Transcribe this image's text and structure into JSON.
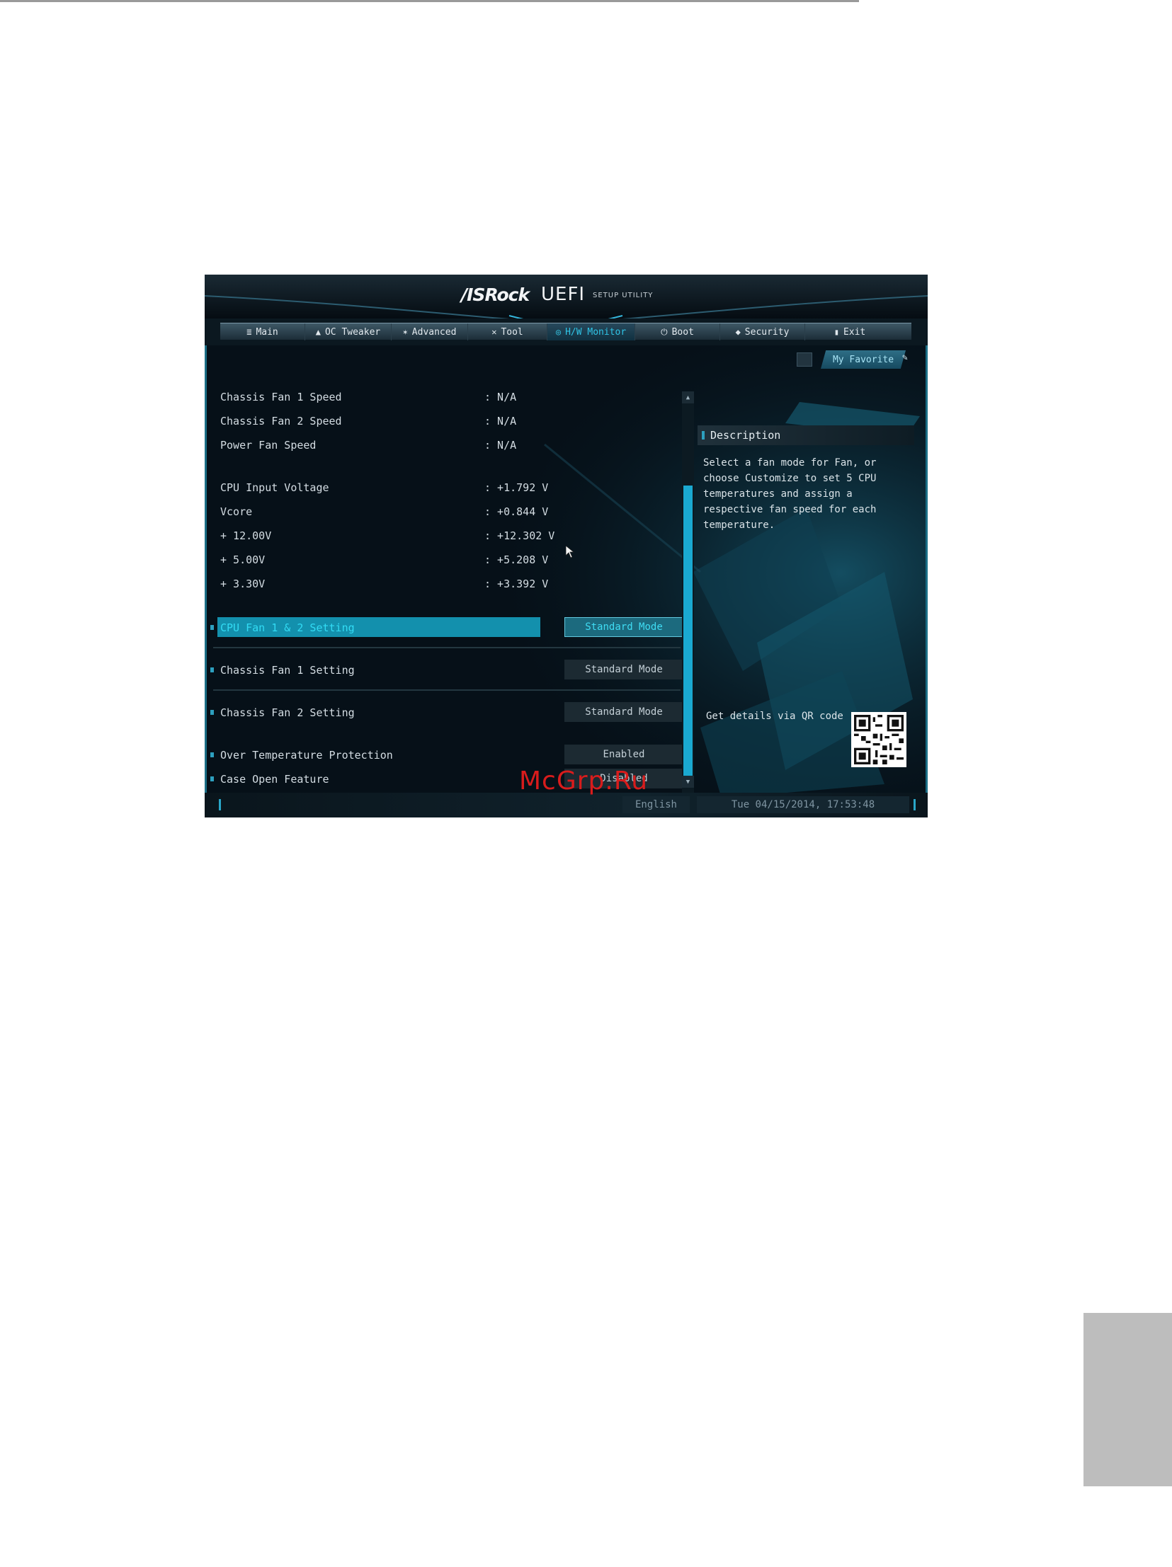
{
  "bios": {
    "brand": "/ISRock",
    "uefi": "UEFI",
    "setup": "SETUP UTILITY",
    "tabs": [
      {
        "label": "Main",
        "icon": "≣"
      },
      {
        "label": "OC Tweaker",
        "icon": "▲"
      },
      {
        "label": "Advanced",
        "icon": "✶"
      },
      {
        "label": "Tool",
        "icon": "✕"
      },
      {
        "label": "H/W Monitor",
        "icon": "◎"
      },
      {
        "label": "Boot",
        "icon": "⏻"
      },
      {
        "label": "Security",
        "icon": "◆"
      },
      {
        "label": "Exit",
        "icon": "▮"
      }
    ],
    "favorite": "My Favorite",
    "readings": [
      {
        "label": "Chassis Fan 1 Speed",
        "value": ": N/A"
      },
      {
        "label": "Chassis Fan 2 Speed",
        "value": ": N/A"
      },
      {
        "label": "Power Fan Speed",
        "value": ": N/A"
      },
      {
        "label": "CPU Input Voltage",
        "value": ": +1.792 V"
      },
      {
        "label": "Vcore",
        "value": ": +0.844 V"
      },
      {
        "label": "+ 12.00V",
        "value": ": +12.302 V"
      },
      {
        "label": "+ 5.00V",
        "value": ": +5.208 V"
      },
      {
        "label": "+ 3.30V",
        "value": ": +3.392 V"
      }
    ],
    "settings": [
      {
        "label": "CPU Fan 1 & 2 Setting",
        "value": "Standard Mode"
      },
      {
        "label": "Chassis Fan 1 Setting",
        "value": "Standard Mode"
      },
      {
        "label": "Chassis Fan 2 Setting",
        "value": "Standard Mode"
      },
      {
        "label": "Over Temperature Protection",
        "value": "Enabled"
      },
      {
        "label": "Case Open Feature",
        "value": "Disabled"
      }
    ],
    "description_title": "Description",
    "description_text": "Select a fan mode for Fan, or choose Customize to set 5 CPU temperatures and assign a respective fan speed for each temperature.",
    "qr_label": "Get details via QR code",
    "language": "English",
    "datetime": "Tue 04/15/2014, 17:53:48"
  },
  "watermark": "McGrp.Ru",
  "colors": {
    "accent": "#1aa9d1",
    "selected_row": "#1390ad",
    "background": "#061018"
  }
}
